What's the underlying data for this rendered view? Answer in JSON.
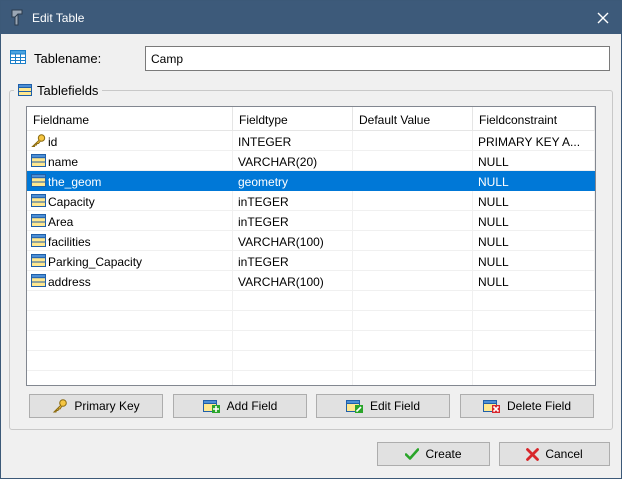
{
  "window": {
    "title": "Edit Table"
  },
  "tablename": {
    "label": "Tablename:",
    "value": "Camp"
  },
  "tablefields": {
    "legend": "Tablefields",
    "columns": [
      "Fieldname",
      "Fieldtype",
      "Default Value",
      "Fieldconstraint"
    ],
    "rows": [
      {
        "icon": "key-icon",
        "name": "id",
        "type": "INTEGER",
        "default": "",
        "constraint": "PRIMARY KEY A..."
      },
      {
        "icon": "field-icon",
        "name": "name",
        "type": "VARCHAR(20)",
        "default": "",
        "constraint": "NULL"
      },
      {
        "icon": "geometry-field-icon",
        "name": "the_geom",
        "type": "geometry",
        "default": "",
        "constraint": "NULL"
      },
      {
        "icon": "field-icon",
        "name": "Capacity",
        "type": "inTEGER",
        "default": "",
        "constraint": "NULL"
      },
      {
        "icon": "field-icon",
        "name": "Area",
        "type": "inTEGER",
        "default": "",
        "constraint": "NULL"
      },
      {
        "icon": "field-icon",
        "name": "facilities",
        "type": "VARCHAR(100)",
        "default": "",
        "constraint": "NULL"
      },
      {
        "icon": "field-icon",
        "name": "Parking_Capacity",
        "type": "inTEGER",
        "default": "",
        "constraint": "NULL"
      },
      {
        "icon": "field-icon",
        "name": "address",
        "type": "VARCHAR(100)",
        "default": "",
        "constraint": "NULL"
      }
    ],
    "selected_index": 2
  },
  "buttons": {
    "primary_key": "Primary Key",
    "add_field": "Add Field",
    "edit_field": "Edit Field",
    "delete_field": "Delete Field",
    "create": "Create",
    "cancel": "Cancel"
  },
  "colors": {
    "titlebar": "#3d5a7a",
    "selection": "#0078d7"
  }
}
